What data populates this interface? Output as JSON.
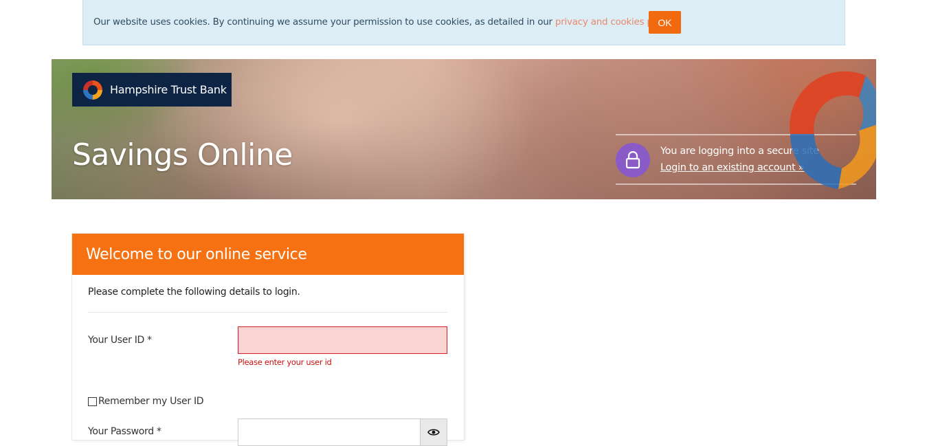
{
  "cookie_banner": {
    "text": "Our website uses cookies. By continuing we assume your permission to use cookies, as detailed in our ",
    "link_text": "privacy and cookies policy",
    "suffix": ".",
    "ok_label": "OK"
  },
  "hero": {
    "brand_name": "Hampshire Trust Bank",
    "title": "Savings Online",
    "secure_text": "You are logging into a secure site",
    "secure_link": "Login to an existing account »",
    "lock_icon": "lock-icon"
  },
  "login_panel": {
    "header": "Welcome to our online service",
    "intro": "Please complete the following details to login.",
    "user_id_label": "Your User ID *",
    "user_id_value": "",
    "user_id_error": "Please enter your user id",
    "remember_label": "Remember my User ID",
    "remember_checked": false,
    "password_label": "Your Password *",
    "password_value": "",
    "password_toggle_icon": "eye-icon"
  },
  "colors": {
    "accent_orange": "#f57112",
    "brand_navy": "#0d2444",
    "error_red": "#cc1010",
    "lock_purple": "#8a5bc7",
    "cookie_bg": "#dcedf6"
  }
}
